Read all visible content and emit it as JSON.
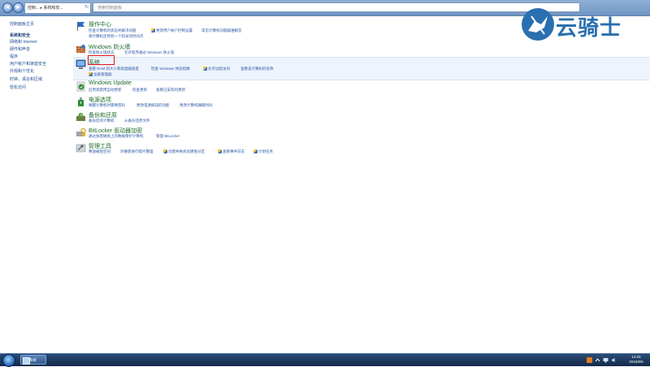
{
  "window": {
    "address_text": "控制... ▸ 系统和安...",
    "search_placeholder": "搜索控制面板",
    "back_glyph": "◄",
    "forward_glyph": "►",
    "refresh_glyph": "↻"
  },
  "sidebar": {
    "items": [
      {
        "label": "控制面板主页",
        "bold": false
      },
      {
        "label": "系统和安全",
        "bold": true
      },
      {
        "label": "网络和 Internet",
        "bold": false
      },
      {
        "label": "硬件和声音",
        "bold": false
      },
      {
        "label": "程序",
        "bold": false
      },
      {
        "label": "用户帐户和家庭安全",
        "bold": false
      },
      {
        "label": "外观和个性化",
        "bold": false
      },
      {
        "label": "时钟、语言和区域",
        "bold": false
      },
      {
        "label": "轻松访问",
        "bold": false
      }
    ]
  },
  "sections": [
    {
      "id": "action-center",
      "title": "操作中心",
      "icon": "flag-icon",
      "links": [
        [
          "检查计算机的状态并解决问题",
          "更改用户帐户控制设置",
          "常见计算机问题疑难解答"
        ],
        [
          "将计算机还原到一个较早的时间点"
        ]
      ]
    },
    {
      "id": "firewall",
      "title": "Windows 防火墙",
      "icon": "firewall-icon",
      "links": [
        [
          "检查防火墙状态",
          "允许程序通过 Windows 防火墙"
        ]
      ]
    },
    {
      "id": "system",
      "title": "系统",
      "icon": "computer-icon",
      "links": [
        [
          "查看 RAM 的大小和处理器速度",
          "检查 Windows 体验指数",
          "允许远程访问",
          "查看该计算机的名称"
        ],
        [
          "设备管理器"
        ]
      ]
    },
    {
      "id": "windows-update",
      "title": "Windows Update",
      "icon": "windows-update-icon",
      "links": [
        [
          "启用或禁用自动更新",
          "检查更新",
          "查看已安装的更新"
        ]
      ]
    },
    {
      "id": "power",
      "title": "电源选项",
      "icon": "power-icon",
      "links": [
        [
          "唤醒计算机时需要密码",
          "更改电源按钮的功能",
          "更改计算机睡眠时间"
        ]
      ]
    },
    {
      "id": "backup",
      "title": "备份和还原",
      "icon": "backup-icon",
      "links": [
        [
          "备份您的计算机",
          "从备份还原文件"
        ]
      ]
    },
    {
      "id": "bitlocker",
      "title": "BitLocker 驱动器加密",
      "icon": "bitlocker-icon",
      "links": [
        [
          "通过加密磁盘上的数据保护计算机",
          "管理 BitLocker"
        ]
      ]
    },
    {
      "id": "admin-tools",
      "title": "管理工具",
      "icon": "admin-tools-icon",
      "links": [
        [
          "释放磁盘空间",
          "对硬盘进行碎片整理",
          "创建并格式化硬盘分区",
          "查看事件日志",
          "计划任务"
        ]
      ]
    }
  ],
  "taskbar": {
    "task_label": "系统",
    "clock_time": "14:25",
    "clock_date": "2019/9/6"
  },
  "watermark": {
    "text": "云骑士"
  },
  "colors": {
    "title_green": "#1c6b2b",
    "link_blue": "#2a56a5",
    "highlight_red": "#e0121c",
    "watermark_blue": "#2a6fb0"
  }
}
